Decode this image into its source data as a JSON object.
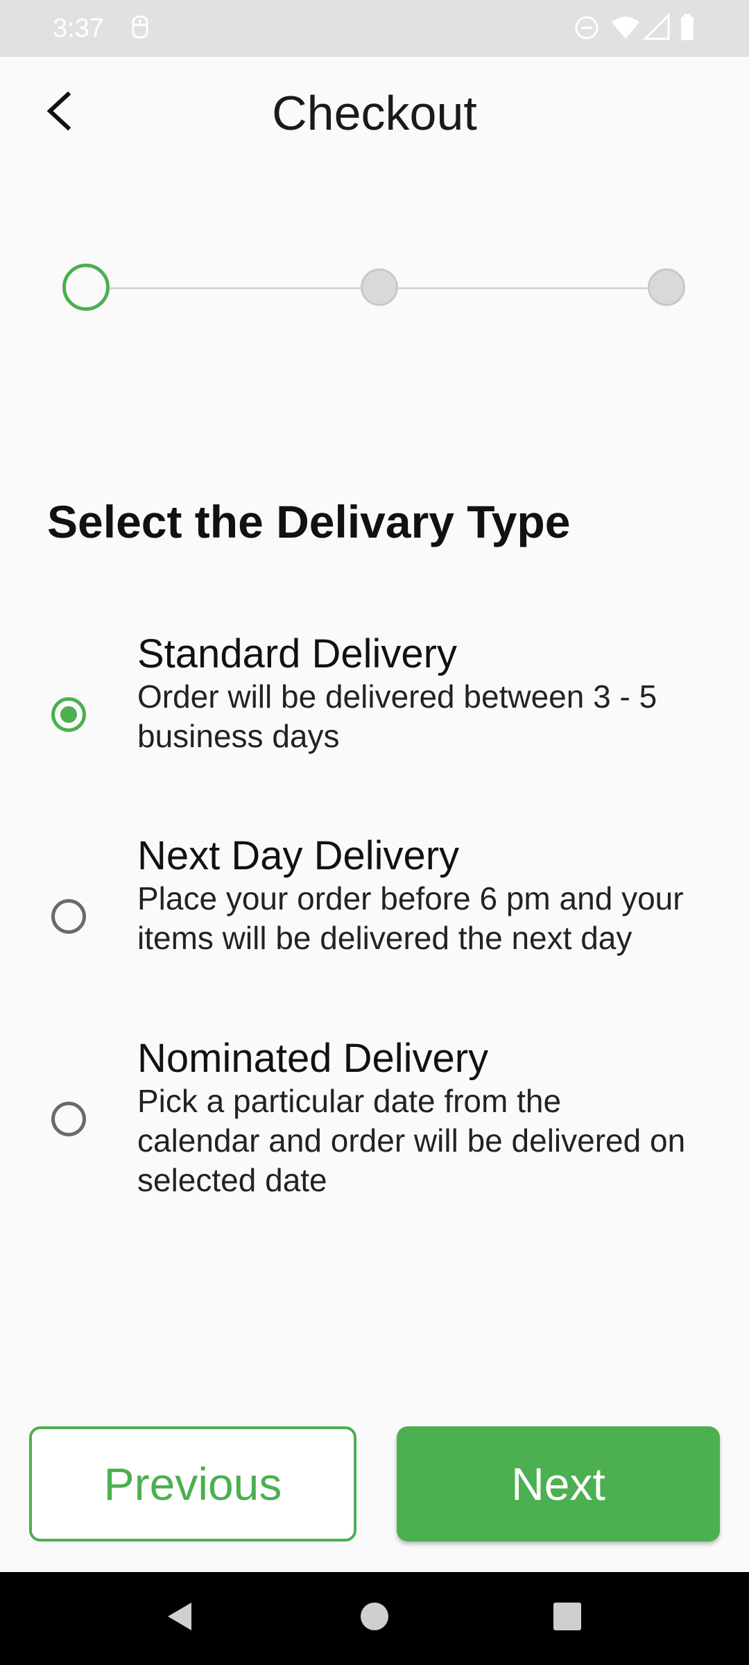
{
  "status_bar": {
    "time": "3:37",
    "icons": [
      "notification-icon",
      "do-not-disturb-icon",
      "wifi-icon",
      "signal-icon",
      "battery-icon"
    ]
  },
  "app_bar": {
    "title": "Checkout",
    "back_icon": "chevron-left-icon"
  },
  "stepper": {
    "total_steps": 3,
    "current_step": 1
  },
  "section": {
    "title": "Select the Delivary Type"
  },
  "delivery_options": [
    {
      "title": "Standard Delivery",
      "description_lines": [
        "Order will be delivered between 3 - 5",
        "business days"
      ],
      "selected": true
    },
    {
      "title": "Next Day Delivery",
      "description_lines": [
        "Place your order before 6 pm and your",
        "items will be delivered the next day"
      ],
      "selected": false
    },
    {
      "title": "Nominated Delivery",
      "description_lines": [
        "Pick a particular date from the",
        "calendar and order will be delivered on",
        "selected date"
      ],
      "selected": false
    }
  ],
  "actions": {
    "previous_label": "Previous",
    "next_label": "Next"
  },
  "colors": {
    "accent": "#4caf50",
    "status_bar_bg": "#e1e1e1",
    "page_bg": "#fafafa",
    "nav_bar_bg": "#000000",
    "inactive_step": "#d9d9d9"
  },
  "nav_bar": {
    "icons": [
      "back-triangle-icon",
      "home-circle-icon",
      "recents-square-icon"
    ]
  }
}
